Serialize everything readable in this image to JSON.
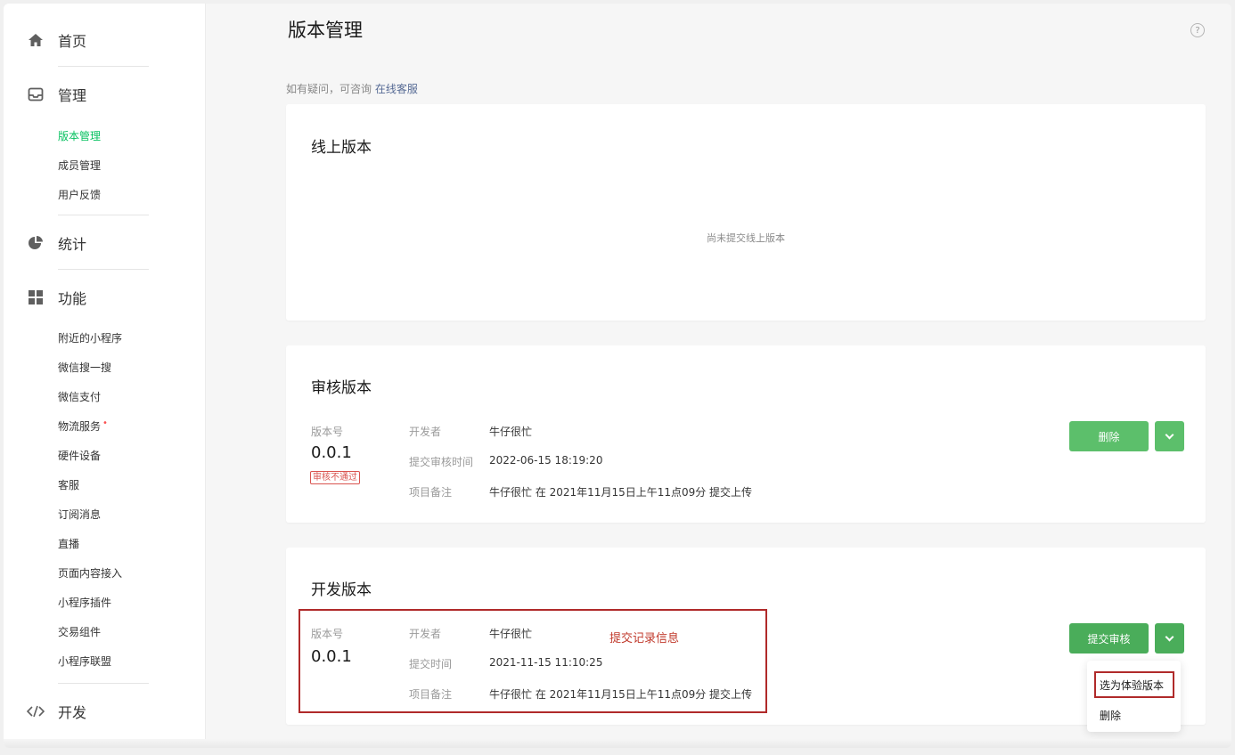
{
  "sidebar": {
    "home": "首页",
    "manage": {
      "label": "管理",
      "items": [
        "版本管理",
        "成员管理",
        "用户反馈"
      ]
    },
    "stats": "统计",
    "features": {
      "label": "功能",
      "items": [
        "附近的小程序",
        "微信搜一搜",
        "微信支付",
        "物流服务",
        "硬件设备",
        "客服",
        "订阅消息",
        "直播",
        "页面内容接入",
        "小程序插件",
        "交易组件",
        "小程序联盟"
      ]
    },
    "dev": "开发",
    "dot_marker": "•"
  },
  "header": {
    "title": "版本管理",
    "help": "?"
  },
  "consult": {
    "prefix": "如有疑问，可咨询",
    "link": "在线客服"
  },
  "online": {
    "title": "线上版本",
    "empty": "尚未提交线上版本"
  },
  "review": {
    "title": "审核版本",
    "version_label": "版本号",
    "version": "0.0.1",
    "status": "审核不通过",
    "rows": [
      {
        "key": "开发者",
        "value": "牛仔很忙"
      },
      {
        "key": "提交审核时间",
        "value": "2022-06-15 18:19:20"
      },
      {
        "key": "项目备注",
        "value": "牛仔很忙 在 2021年11月15日上午11点09分 提交上传"
      }
    ],
    "delete_button": "删除"
  },
  "dev": {
    "title": "开发版本",
    "version_label": "版本号",
    "version": "0.0.1",
    "rows": [
      {
        "key": "开发者",
        "value": "牛仔很忙"
      },
      {
        "key": "提交时间",
        "value": "2021-11-15 11:10:25"
      },
      {
        "key": "项目备注",
        "value": "牛仔很忙 在 2021年11月15日上午11点09分 提交上传"
      }
    ],
    "submit_button": "提交审核",
    "annotation": "提交记录信息",
    "dropdown": [
      "选为体验版本",
      "删除"
    ]
  },
  "colors": {
    "accent_green": "#07c160",
    "button_green": "#5cbf6b",
    "link_blue": "#576b95",
    "annotation_red": "#b02a2a"
  }
}
